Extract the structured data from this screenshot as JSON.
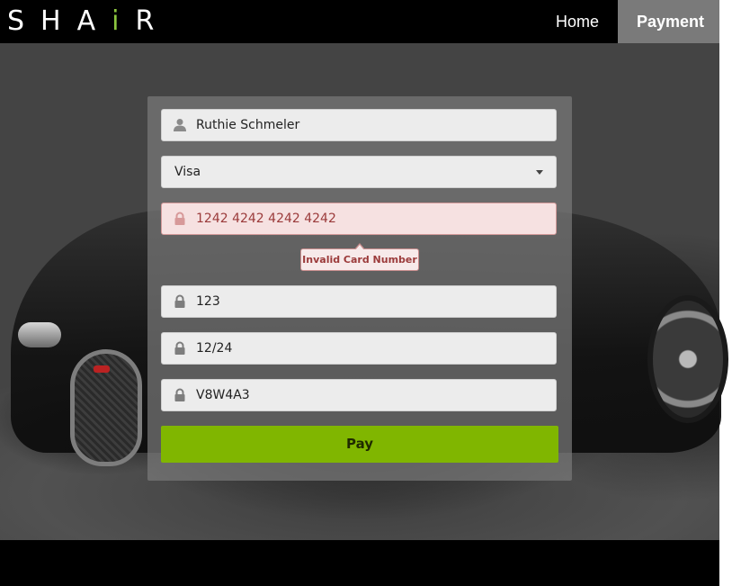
{
  "brand": {
    "logo_part1": "SHA",
    "logo_accent": "i",
    "logo_part2": "R",
    "accent_color": "#8cc63f"
  },
  "nav": {
    "items": [
      {
        "label": "Home",
        "active": false
      },
      {
        "label": "Payment",
        "active": true
      }
    ]
  },
  "form": {
    "name": {
      "value": "Ruthie Schmeler",
      "icon": "user-icon"
    },
    "card_type": {
      "value": "Visa",
      "icon": "chevron-down-icon"
    },
    "card_number": {
      "value": "1242 4242 4242 4242",
      "icon": "lock-icon",
      "state": "error"
    },
    "error_tooltip": "Invalid Card Number",
    "cvc": {
      "value": "123",
      "icon": "lock-icon"
    },
    "expiry": {
      "value": "12/24",
      "icon": "lock-icon"
    },
    "postal": {
      "value": "V8W4A3",
      "icon": "lock-icon"
    },
    "submit_label": "Pay",
    "colors": {
      "button": "#80b600",
      "error_text": "#9b3b3b",
      "error_bg": "#f6e1e1"
    }
  }
}
